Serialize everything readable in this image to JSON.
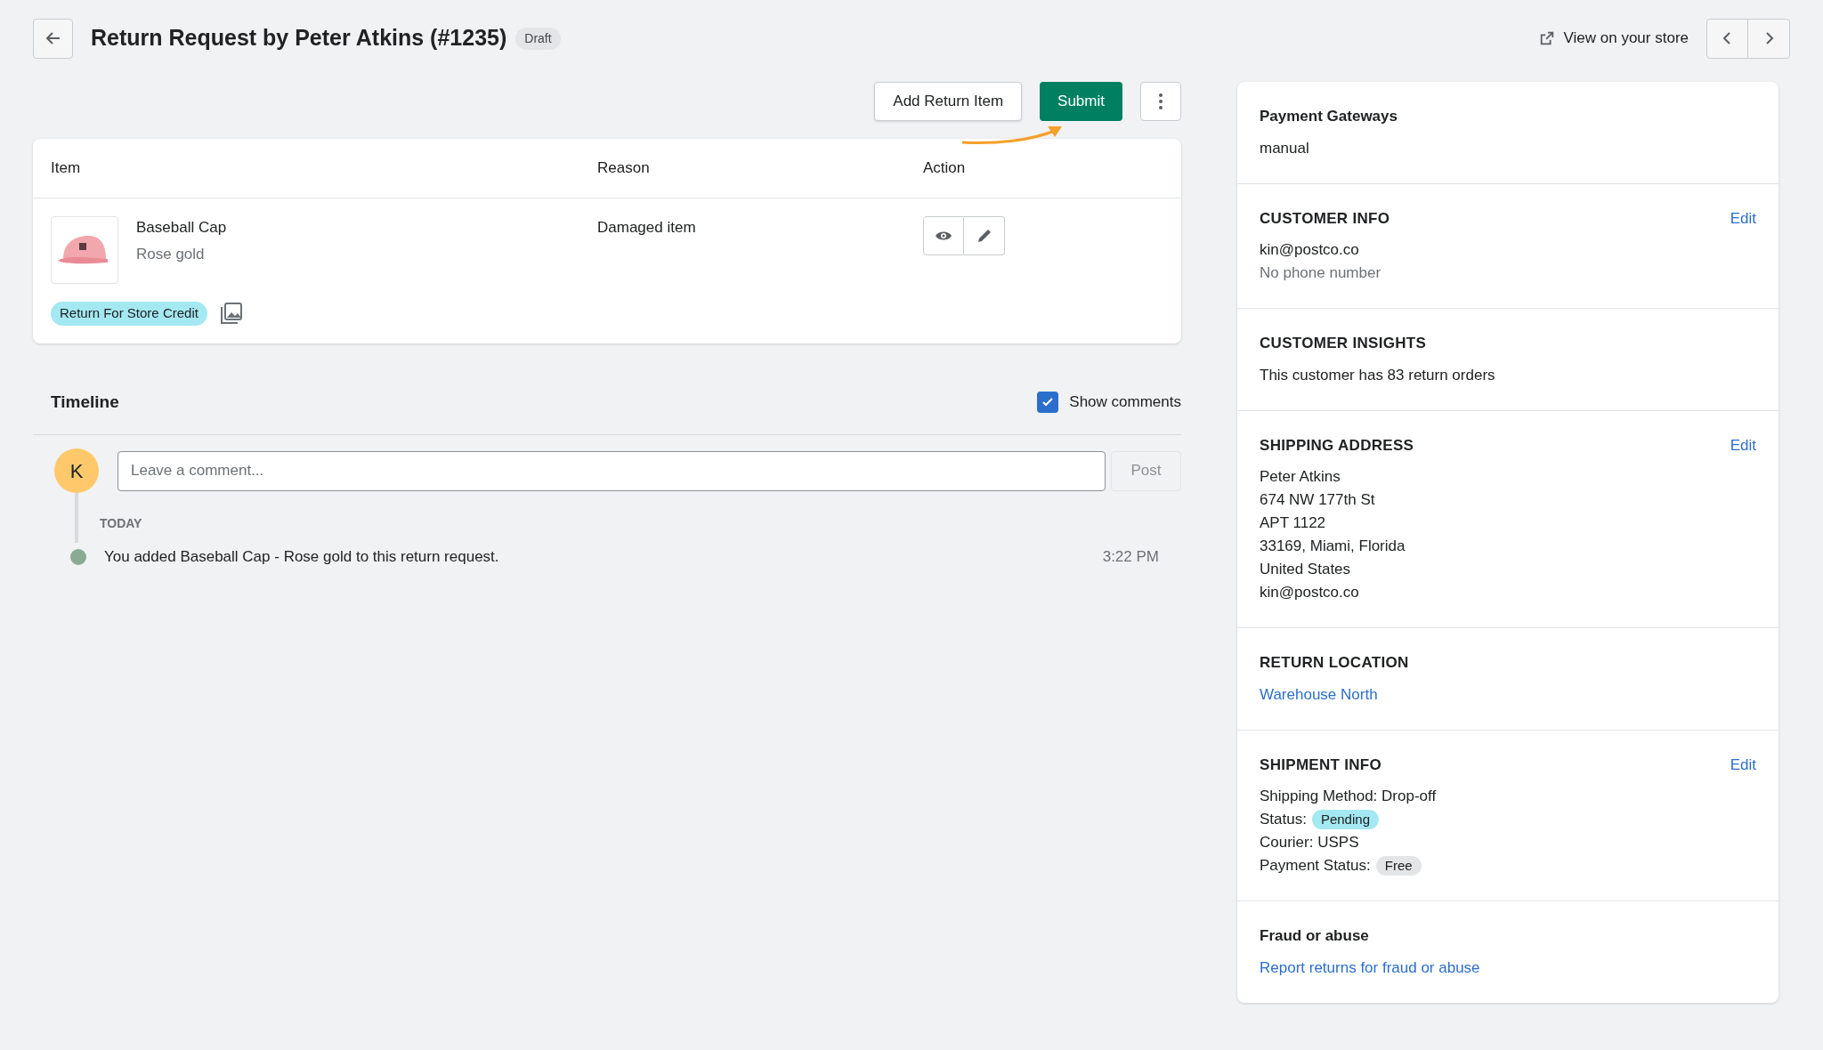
{
  "header": {
    "title": "Return Request by Peter Atkins (#1235)",
    "badge": "Draft",
    "store_link": "View on your store"
  },
  "actions": {
    "add_button": "Add Return Item",
    "submit_button": "Submit"
  },
  "table": {
    "columns": [
      "Item",
      "Reason",
      "Action"
    ],
    "rows": [
      {
        "name": "Baseball Cap",
        "variant": "Rose gold",
        "reason": "Damaged item",
        "tag": "Return For Store Credit"
      }
    ]
  },
  "timeline": {
    "title": "Timeline",
    "show_comments": {
      "label": "Show comments",
      "checked": true
    },
    "avatar": "K",
    "comment": {
      "placeholder": "Leave a comment...",
      "button": "Post",
      "disabled": true
    },
    "groups": [
      {
        "label": "TODAY",
        "events": [
          {
            "text": "You added Baseball Cap - Rose gold to this return request.",
            "time": "3:22 PM"
          }
        ]
      }
    ]
  },
  "sidebar": [
    {
      "title": "Payment Gateways",
      "kind": "plain",
      "lines": [
        {
          "kind": "text",
          "text": "manual"
        }
      ]
    },
    {
      "title": "CUSTOMER INFO",
      "kind": "caps",
      "edit": "Edit",
      "lines": [
        {
          "kind": "text",
          "text": "kin@postco.co"
        },
        {
          "kind": "muted",
          "text": "No phone number"
        }
      ]
    },
    {
      "title": "CUSTOMER INSIGHTS",
      "kind": "caps",
      "lines": [
        {
          "kind": "text",
          "text": "This customer has 83 return orders"
        }
      ]
    },
    {
      "title": "SHIPPING ADDRESS",
      "kind": "caps",
      "edit": "Edit",
      "lines": [
        {
          "kind": "text",
          "text": "Peter Atkins"
        },
        {
          "kind": "text",
          "text": "674 NW 177th St"
        },
        {
          "kind": "text",
          "text": "APT 1122"
        },
        {
          "kind": "text",
          "text": "33169, Miami, Florida"
        },
        {
          "kind": "text",
          "text": "United States"
        },
        {
          "kind": "text",
          "text": "kin@postco.co"
        }
      ]
    },
    {
      "title": "RETURN LOCATION",
      "kind": "caps",
      "lines": [
        {
          "kind": "link",
          "text": "Warehouse North"
        }
      ]
    },
    {
      "title": "SHIPMENT INFO",
      "kind": "caps",
      "edit": "Edit",
      "lines": [
        {
          "kind": "text",
          "text": "Shipping Method: Drop-off"
        },
        {
          "kind": "badge",
          "text": "Status:",
          "badge": "Pending",
          "color": "#a4e8f2"
        },
        {
          "kind": "text",
          "text": "Courier: USPS"
        },
        {
          "kind": "badge",
          "text": "Payment Status:",
          "badge": "Free",
          "color": "#e4e5e7"
        }
      ]
    },
    {
      "title": "Fraud or abuse",
      "kind": "plain",
      "lines": [
        {
          "kind": "link",
          "text": "Report returns for fraud or abuse"
        }
      ]
    }
  ]
}
